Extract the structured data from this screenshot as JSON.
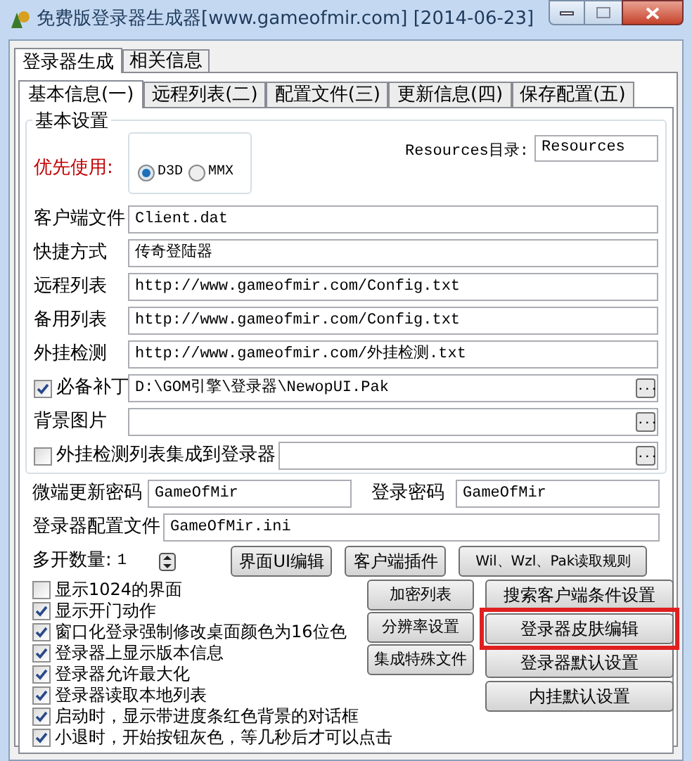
{
  "window": {
    "title": "免费版登录器生成器[www.gameofmir.com] [2014-06-23]"
  },
  "tabs": [
    {
      "label": "登录器生成",
      "selected": true
    },
    {
      "label": "相关信息",
      "selected": false
    }
  ],
  "subtabs": [
    {
      "label": "基本信息(一)",
      "selected": true
    },
    {
      "label": "远程列表(二)",
      "selected": false
    },
    {
      "label": "配置文件(三)",
      "selected": false
    },
    {
      "label": "更新信息(四)",
      "selected": false
    },
    {
      "label": "保存配置(五)",
      "selected": false
    }
  ],
  "group": {
    "title": "基本设置"
  },
  "priority": {
    "label": "优先使用:",
    "options": [
      {
        "label": "D3D",
        "selected": true
      },
      {
        "label": "MMX",
        "selected": false
      }
    ]
  },
  "resources": {
    "label": "Resources目录:",
    "value": "Resources"
  },
  "fields": [
    {
      "kind": "text",
      "label": "客户端文件",
      "value": "Client.dat"
    },
    {
      "kind": "text",
      "label": "快捷方式",
      "value": "传奇登陆器"
    },
    {
      "kind": "text",
      "label": "远程列表",
      "value": "http://www.gameofmir.com/Config.txt"
    },
    {
      "kind": "text",
      "label": "备用列表",
      "value": "http://www.gameofmir.com/Config.txt"
    },
    {
      "kind": "text",
      "label": "外挂检测",
      "value": "http://www.gameofmir.com/外挂检测.txt"
    },
    {
      "kind": "check",
      "label": "必备补丁",
      "checked": true,
      "value": "D:\\GOM引擎\\登录器\\NewopUI.Pak",
      "browse": "..."
    },
    {
      "kind": "text",
      "label": "背景图片",
      "browse": "..."
    },
    {
      "kind": "check",
      "label": "外挂检测列表集成到登录器",
      "checked": false,
      "browse": "..."
    }
  ],
  "passwords": [
    {
      "label": "微端更新密码",
      "value": "GameOfMir"
    },
    {
      "label": "登录密码",
      "value": "GameOfMir"
    }
  ],
  "config_file": {
    "label": "登录器配置文件",
    "value": "GameOfMir.ini"
  },
  "instances": {
    "label": "多开数量:",
    "value": "1"
  },
  "top_buttons": [
    {
      "label": "界面UI编辑",
      "highlighted": false
    },
    {
      "label": "客户端插件",
      "highlighted": false
    },
    {
      "label": "Wil、Wzl、Pak读取规则",
      "highlighted": false
    }
  ],
  "middle_buttons": [
    {
      "label": "加密列表",
      "highlighted": false
    },
    {
      "label": "分辨率设置",
      "highlighted": false
    },
    {
      "label": "集成特殊文件",
      "highlighted": false
    }
  ],
  "right_buttons": [
    {
      "label": "搜索客户端条件设置",
      "highlighted": false
    },
    {
      "label": "登录器皮肤编辑",
      "highlighted": true
    },
    {
      "label": "登录器默认设置",
      "highlighted": false
    },
    {
      "label": "内挂默认设置",
      "highlighted": false
    }
  ],
  "options": [
    {
      "label": "显示1024的界面",
      "checked": false
    },
    {
      "label": "显示开门动作",
      "checked": true
    },
    {
      "label": "窗口化登录强制修改桌面颜色为16位色",
      "checked": true
    },
    {
      "label": "登录器上显示版本信息",
      "checked": true
    },
    {
      "label": "登录器允许最大化",
      "checked": true
    },
    {
      "label": "登录器读取本地列表",
      "checked": true
    },
    {
      "label": "启动时，显示带进度条红色背景的对话框",
      "checked": true
    },
    {
      "label": "小退时，开始按钮灰色，等几秒后才可以点击",
      "checked": true
    }
  ]
}
